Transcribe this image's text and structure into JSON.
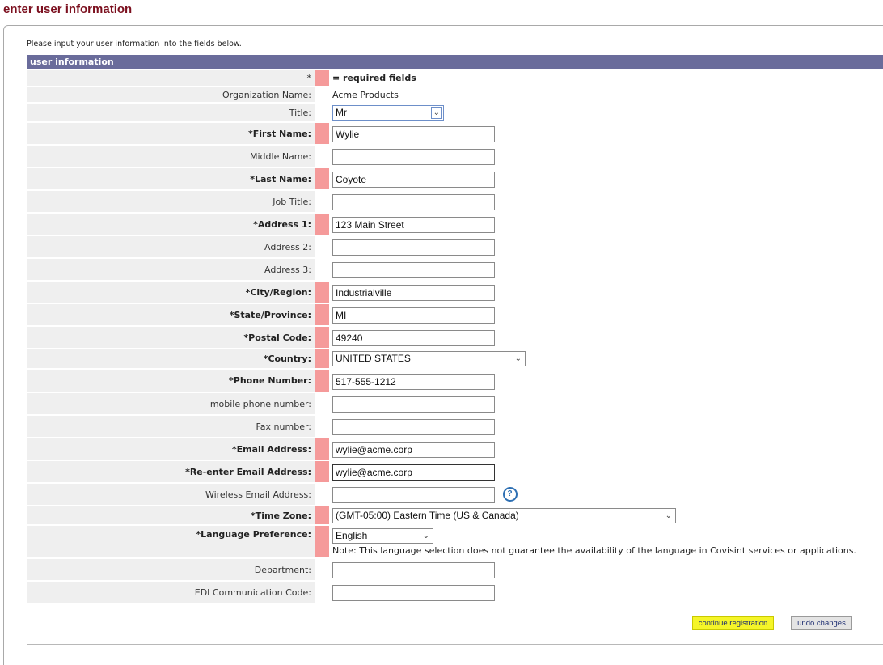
{
  "page": {
    "title": "enter user information"
  },
  "intro": "Please input your user information into the fields below.",
  "section": {
    "header": "user information"
  },
  "legend": {
    "star": "*",
    "text": "= required fields"
  },
  "org": {
    "label": "Organization Name:",
    "value": "Acme Products"
  },
  "fields": {
    "title": {
      "label": "Title:",
      "value": "Mr"
    },
    "first_name": {
      "label": "*First Name:",
      "value": "Wylie"
    },
    "middle_name": {
      "label": "Middle Name:",
      "value": ""
    },
    "last_name": {
      "label": "*Last Name:",
      "value": "Coyote"
    },
    "job_title": {
      "label": "Job Title:",
      "value": ""
    },
    "address1": {
      "label": "*Address 1:",
      "value": "123 Main Street"
    },
    "address2": {
      "label": "Address 2:",
      "value": ""
    },
    "address3": {
      "label": "Address 3:",
      "value": ""
    },
    "city": {
      "label": "*City/Region:",
      "value": "Industrialville"
    },
    "state": {
      "label": "*State/Province:",
      "value": "MI"
    },
    "postal": {
      "label": "*Postal Code:",
      "value": "49240"
    },
    "country": {
      "label": "*Country:",
      "value": "UNITED STATES"
    },
    "phone": {
      "label": "*Phone Number:",
      "value": "517-555-1212"
    },
    "mobile": {
      "label": "mobile phone number:",
      "value": ""
    },
    "fax": {
      "label": "Fax number:",
      "value": ""
    },
    "email": {
      "label": "*Email Address:",
      "value": "wylie@acme.corp"
    },
    "email2": {
      "label": "*Re-enter Email Address:",
      "value": "wylie@acme.corp"
    },
    "wireless": {
      "label": "Wireless Email Address:",
      "value": "",
      "help_icon": "help-question-icon"
    },
    "timezone": {
      "label": "*Time Zone:",
      "value": "(GMT-05:00) Eastern Time (US & Canada)"
    },
    "language": {
      "label": "*Language Preference:",
      "value": "English",
      "note": "Note: This language selection does not guarantee the availability of the language in Covisint services or applications."
    },
    "department": {
      "label": "Department:",
      "value": ""
    },
    "edi": {
      "label": "EDI Communication Code:",
      "value": ""
    }
  },
  "buttons": {
    "continue": "continue registration",
    "undo": "undo changes"
  },
  "colors": {
    "title": "#7b0f1e",
    "header": "#6a6c9b",
    "required": "#f59a9a",
    "highlight": "#f5f528"
  }
}
